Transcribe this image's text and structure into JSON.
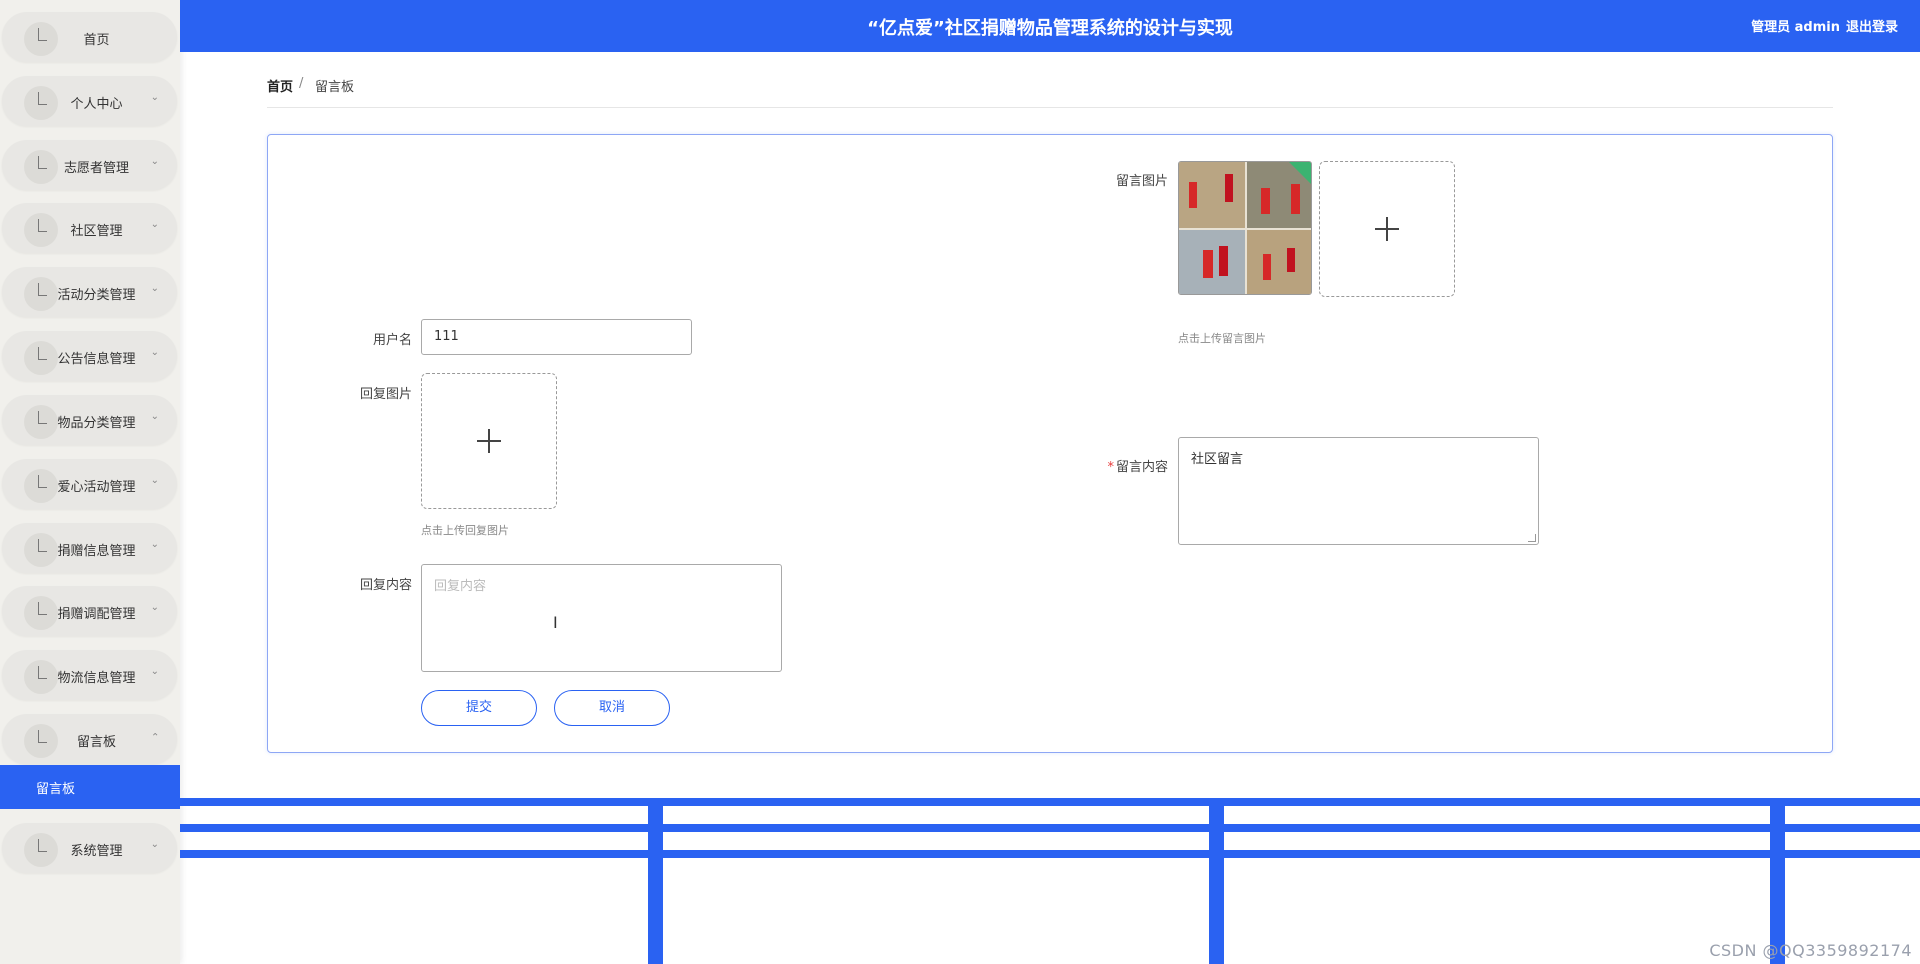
{
  "header": {
    "title": "“亿点爱”社区捐赠物品管理系统的设计与实现",
    "user": "管理员 admin",
    "logout": "退出登录"
  },
  "sidebar": {
    "items": [
      {
        "label": "首页",
        "arrow": ""
      },
      {
        "label": "个人中心",
        "arrow": "⌄"
      },
      {
        "label": "志愿者管理",
        "arrow": "⌄"
      },
      {
        "label": "社区管理",
        "arrow": "⌄"
      },
      {
        "label": "活动分类管理",
        "arrow": "⌄"
      },
      {
        "label": "公告信息管理",
        "arrow": "⌄"
      },
      {
        "label": "物品分类管理",
        "arrow": "⌄"
      },
      {
        "label": "爱心活动管理",
        "arrow": "⌄"
      },
      {
        "label": "捐赠信息管理",
        "arrow": "⌄"
      },
      {
        "label": "捐赠调配管理",
        "arrow": "⌄"
      },
      {
        "label": "物流信息管理",
        "arrow": "⌄"
      },
      {
        "label": "留言板",
        "arrow": "⌄"
      },
      {
        "label": "系统管理",
        "arrow": "⌄"
      }
    ],
    "active_sub": "留言板"
  },
  "breadcrumb": {
    "home": "首页",
    "separator": "/",
    "current": "留言板"
  },
  "form": {
    "username_label": "用户名",
    "username_value": "111",
    "reply_image_label": "回复图片",
    "reply_image_hint": "点击上传回复图片",
    "reply_content_label": "回复内容",
    "reply_content_placeholder": "回复内容",
    "message_image_label": "留言图片",
    "message_image_hint": "点击上传留言图片",
    "message_content_label": "留言内容",
    "message_content_value": "社区留言",
    "submit": "提交",
    "cancel": "取消"
  },
  "watermark": "CSDN @QQ3359892174",
  "colors": {
    "primary": "#2a62f2",
    "sidebar_bg": "#f1f0ec",
    "required": "#e63b3b"
  },
  "icons": [
    "plus-icon",
    "chevron-down-icon",
    "chevron-up-icon",
    "menu-icon",
    "text-cursor-icon"
  ]
}
